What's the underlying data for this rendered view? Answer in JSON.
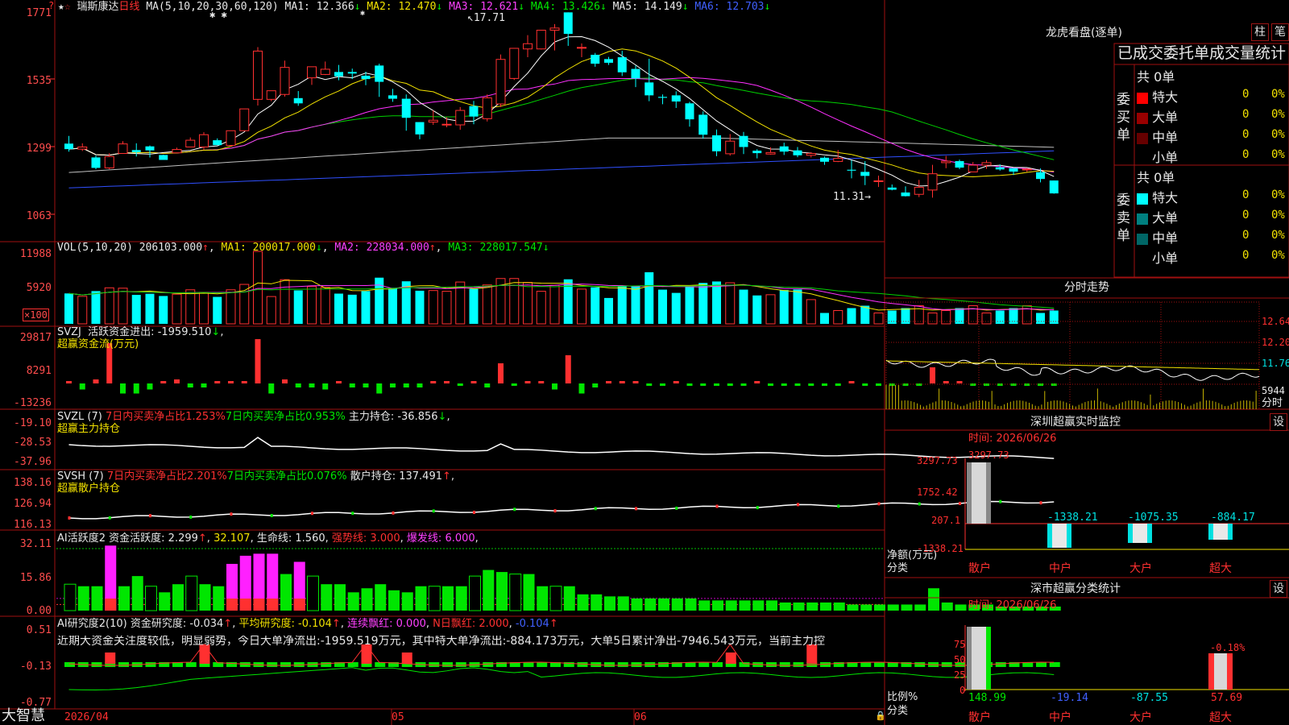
{
  "header": {
    "stock_name": "瑞斯康达",
    "period": "日线",
    "ma_label": "MA(5,10,20,30,60,120)",
    "ma_values": [
      {
        "label": "MA1:",
        "value": "12.366",
        "arrow": "↓",
        "color": "#e8e8e8"
      },
      {
        "label": "MA2:",
        "value": "12.470",
        "arrow": "↓",
        "color": "#f2e200"
      },
      {
        "label": "MA3:",
        "value": "12.621",
        "arrow": "↓",
        "color": "#ff40ff"
      },
      {
        "label": "MA4:",
        "value": "13.426",
        "arrow": "↓",
        "color": "#00e600"
      },
      {
        "label": "MA5:",
        "value": "14.149",
        "arrow": "↓",
        "color": "#e8e8e8"
      },
      {
        "label": "MA6:",
        "value": "12.703",
        "arrow": "↓",
        "color": "#4060ff"
      }
    ],
    "high_marker": "17.71",
    "low_marker": "11.31"
  },
  "price_axis": [
    "1771",
    "1535",
    "1299",
    "1063"
  ],
  "volume": {
    "title": "VOL(5,10,20)",
    "value": "206103.000",
    "value_arrow": "↑",
    "ma": [
      {
        "label": "MA1:",
        "value": "200017.000",
        "arrow": "↓",
        "color": "#f2e200"
      },
      {
        "label": "MA2:",
        "value": "228034.000",
        "arrow": "↑",
        "color": "#ff40ff"
      },
      {
        "label": "MA3:",
        "value": "228017.547",
        "arrow": "↓",
        "color": "#00e600"
      }
    ],
    "axis": [
      "11988",
      "5920",
      "×100"
    ]
  },
  "svzj": {
    "title": "SVZJ",
    "label": "活跃资金进出:",
    "value": "-1959.510",
    "arrow": "↓",
    "subtitle": "超赢资金流(万元)",
    "axis": [
      "29817",
      "8291",
      "-13236"
    ]
  },
  "svzl": {
    "title": "SVZL (7)",
    "buy1": "7日内买卖净占比1.253%",
    "buy2": "7日内买卖净占比0.953%",
    "label": "主力持仓:",
    "value": "-36.856",
    "arrow": "↓",
    "subtitle": "超赢主力持仓",
    "axis": [
      "-19.10",
      "-28.53",
      "-37.96"
    ]
  },
  "svsh": {
    "title": "SVSH (7)",
    "buy1": "7日内买卖净占比2.201%",
    "buy2": "7日内买卖净占比0.076%",
    "label": "散户持仓:",
    "value": "137.491",
    "arrow": "↑",
    "subtitle": "超赢散户持仓",
    "axis": [
      "138.16",
      "126.94",
      "116.13"
    ]
  },
  "ai_active": {
    "title": "AI活跃度2",
    "label": "资金活跃度:",
    "value": "2.299",
    "arrow": "↑",
    "value2": "32.107",
    "life_label": "生命线:",
    "life_value": "1.560",
    "strong_label": "强势线:",
    "strong_value": "3.000",
    "burst_label": "爆发线:",
    "burst_value": "6.000",
    "axis": [
      "32.11",
      "15.86",
      "0.00"
    ]
  },
  "ai_research": {
    "title": "AI研究度2(10)",
    "label": "资金研究度:",
    "value": "-0.034",
    "avg_label": "平均研究度:",
    "avg_value": "-0.104",
    "red_label": "连续飘红:",
    "red_value": "0.000",
    "nred_label": "N日飘红:",
    "nred_value": "2.000",
    "last_value": "-0.104",
    "comment": "近期大资金关注度较低，明显弱势，今日大单净流出:-1959.519万元，其中特大单净流出:-884.173万元，大单5日累计净出-7946.543万元，当前主力控",
    "axis": [
      "0.51",
      "-0.13",
      "-0.77"
    ]
  },
  "time_axis": [
    "2026/04",
    "05",
    "06"
  ],
  "app_name": "大智慧",
  "right": {
    "dragon_title": "龙虎看盘(逐单)",
    "tab_zhu": "柱",
    "tab_bi": "笔",
    "stats_title": "已成交委托单成交量统计",
    "buy_side": {
      "label": "委买单",
      "total": "共 0单",
      "rows": [
        {
          "name": "特大",
          "count": "0",
          "pct": "0%",
          "color": "#ff0000"
        },
        {
          "name": "大单",
          "count": "0",
          "pct": "0%",
          "color": "#990000"
        },
        {
          "name": "中单",
          "count": "0",
          "pct": "0%",
          "color": "#660000"
        },
        {
          "name": "小单",
          "count": "0",
          "pct": "0%",
          "color": ""
        }
      ]
    },
    "sell_side": {
      "label": "委卖单",
      "total": "共 0单",
      "rows": [
        {
          "name": "特大",
          "count": "0",
          "pct": "0%",
          "color": "#00ffff"
        },
        {
          "name": "大单",
          "count": "0",
          "pct": "0%",
          "color": "#008080"
        },
        {
          "name": "中单",
          "count": "0",
          "pct": "0%",
          "color": "#006666"
        },
        {
          "name": "小单",
          "count": "0",
          "pct": "0%",
          "color": ""
        }
      ]
    },
    "intraday": {
      "title": "分时走势",
      "axis": [
        "12.64",
        "12.20",
        "11.76",
        "5944"
      ],
      "time_label": "分时"
    },
    "monitor": {
      "title": "深圳超赢实时监控",
      "settings": "设",
      "time": "时间: 2026/06/26",
      "axis": [
        "3297.73",
        "1752.42",
        "207.1",
        "-1338.21"
      ],
      "y_label": "净额(万元)",
      "x_label": "分类",
      "bars": [
        {
          "name": "散户",
          "value": "3297.73"
        },
        {
          "name": "中户",
          "value": "-1338.21"
        },
        {
          "name": "大户",
          "value": "-1075.35"
        },
        {
          "name": "超大",
          "value": "-884.17"
        }
      ]
    },
    "classify": {
      "title": "深市超赢分类统计",
      "settings": "设",
      "time": "时间: 2026/06/26",
      "axis": [
        "75",
        "50",
        "25",
        "0"
      ],
      "y_label": "比例%",
      "x_label": "分类",
      "top_value": "-0.18%",
      "bars": [
        {
          "name": "散户",
          "value": "148.99"
        },
        {
          "name": "中户",
          "value": "-19.14"
        },
        {
          "name": "大户",
          "value": "-87.55"
        },
        {
          "name": "超大",
          "value": "57.69"
        }
      ]
    }
  },
  "chart_data": {
    "type": "candlestick",
    "candles": [
      [
        13.44,
        13.26,
        13.69,
        13.18
      ],
      [
        13.26,
        13.33,
        13.45,
        13.2
      ],
      [
        12.99,
        12.65,
        13.05,
        12.61
      ],
      [
        12.65,
        13.02,
        13.13,
        12.61
      ],
      [
        13.12,
        13.43,
        13.52,
        13.12
      ],
      [
        13.23,
        13.16,
        13.45,
        13.02
      ],
      [
        13.35,
        13.22,
        13.38,
        12.99
      ],
      [
        13.07,
        12.91,
        13.08,
        12.91
      ],
      [
        13.14,
        13.25,
        13.31,
        13.14
      ],
      [
        13.33,
        13.55,
        13.64,
        13.33
      ],
      [
        13.33,
        13.73,
        13.81,
        13.24
      ],
      [
        13.55,
        13.39,
        13.61,
        13.39
      ],
      [
        13.38,
        13.86,
        13.86,
        13.35
      ],
      [
        13.86,
        14.57,
        14.57,
        13.86
      ],
      [
        14.88,
        16.45,
        16.58,
        14.68
      ],
      [
        14.88,
        15.16,
        15.16,
        14.82
      ],
      [
        15.04,
        15.92,
        16.14,
        14.97
      ],
      [
        14.92,
        14.75,
        15.15,
        14.67
      ],
      [
        15.58,
        15.94,
        15.94,
        15.35
      ],
      [
        15.69,
        15.86,
        16.11,
        15.67
      ],
      [
        15.77,
        15.63,
        16.0,
        15.5
      ],
      [
        15.77,
        15.72,
        15.88,
        15.54
      ],
      [
        15.65,
        15.54,
        15.78,
        15.34
      ],
      [
        15.98,
        15.45,
        16.04,
        14.96
      ],
      [
        15.01,
        14.9,
        15.22,
        14.8
      ],
      [
        14.9,
        14.28,
        15.04,
        13.86
      ],
      [
        14.14,
        13.74,
        14.14,
        13.58
      ],
      [
        14.14,
        14.2,
        14.52,
        14.05
      ],
      [
        14.05,
        14.07,
        14.3,
        13.97
      ],
      [
        14.05,
        14.52,
        14.63,
        13.89
      ],
      [
        14.66,
        14.32,
        14.83,
        14.07
      ],
      [
        14.25,
        14.93,
        15.04,
        14.16
      ],
      [
        14.73,
        16.18,
        16.34,
        14.63
      ],
      [
        15.56,
        16.54,
        16.54,
        15.51
      ],
      [
        16.52,
        16.69,
        16.97,
        16.25
      ],
      [
        16.52,
        17.13,
        17.13,
        16.5
      ],
      [
        17.13,
        17.2,
        17.33,
        16.47
      ],
      [
        17.71,
        17.01,
        17.71,
        16.62
      ],
      [
        16.57,
        16.57,
        16.7,
        16.25
      ],
      [
        16.33,
        16.04,
        16.39,
        15.94
      ],
      [
        16.19,
        16.07,
        16.26,
        16.0
      ],
      [
        16.25,
        15.76,
        16.46,
        15.64
      ],
      [
        15.87,
        15.56,
        15.98,
        15.28
      ],
      [
        15.43,
        15.01,
        16.2,
        14.82
      ],
      [
        14.96,
        14.93,
        15.04,
        14.72
      ],
      [
        15.01,
        14.81,
        15.14,
        14.6
      ],
      [
        14.75,
        14.23,
        14.8,
        13.99
      ],
      [
        14.38,
        13.73,
        14.49,
        13.6
      ],
      [
        13.71,
        13.19,
        13.9,
        13.03
      ],
      [
        13.11,
        13.52,
        13.75,
        13.05
      ],
      [
        13.69,
        13.33,
        13.82,
        13.1
      ],
      [
        13.21,
        13.13,
        13.26,
        12.96
      ],
      [
        13.1,
        13.15,
        13.32,
        13.08
      ],
      [
        13.35,
        13.18,
        13.47,
        13.07
      ],
      [
        13.22,
        13.06,
        13.33,
        13.0
      ],
      [
        13.06,
        13.12,
        13.16,
        12.99
      ],
      [
        12.98,
        12.85,
        13.02,
        12.75
      ],
      [
        12.86,
        12.96,
        13.23,
        12.84
      ],
      [
        12.59,
        12.56,
        12.9,
        12.31
      ],
      [
        12.52,
        12.39,
        12.87,
        12.09
      ],
      [
        12.23,
        12.23,
        12.4,
        12.03
      ],
      [
        12.01,
        11.94,
        12.11,
        11.92
      ],
      [
        11.85,
        11.73,
        12.05,
        11.72
      ],
      [
        11.79,
        12.02,
        12.26,
        11.7
      ],
      [
        11.93,
        12.46,
        12.75,
        11.68
      ],
      [
        12.82,
        12.87,
        13.04,
        12.64
      ],
      [
        12.87,
        12.66,
        12.92,
        12.61
      ],
      [
        12.52,
        12.74,
        12.84,
        12.52
      ],
      [
        12.74,
        12.82,
        12.9,
        12.62
      ],
      [
        12.67,
        12.6,
        12.76,
        12.56
      ],
      [
        12.64,
        12.53,
        12.63,
        12.42
      ],
      [
        12.59,
        12.61,
        12.64,
        12.52
      ],
      [
        12.51,
        12.29,
        12.63,
        12.18
      ],
      [
        12.24,
        11.82,
        12.24,
        11.81
      ]
    ],
    "ylim": [
      10.25,
      17.85
    ]
  }
}
